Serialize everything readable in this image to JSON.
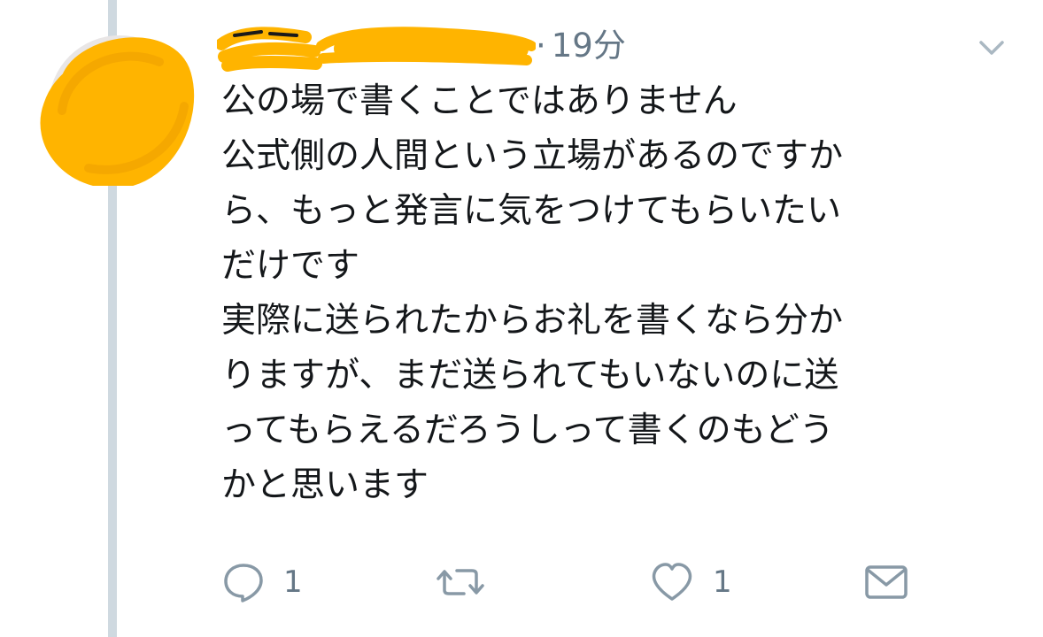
{
  "tweet": {
    "time": "19分",
    "lines": [
      "公の場で書くことではありません",
      "公式側の人間という立場があるのですか",
      "ら、もっと発言に気をつけてもらいたい",
      "だけです",
      "実際に送られたからお礼を書くなら分か",
      "りますが、まだ送られてもいないのに送",
      "ってもらえるだろうしって書くのもどう",
      "かと思います"
    ]
  },
  "actions": {
    "reply_count": "1",
    "like_count": "1"
  },
  "icons": {
    "reply": "reply-bubble-icon",
    "retweet": "retweet-icon",
    "like": "heart-icon",
    "dm": "envelope-icon",
    "menu": "chevron-down-icon"
  },
  "colors": {
    "thread_line": "#cfd9e0",
    "text": "#14171a",
    "meta": "#657786",
    "redaction": "#ffb400"
  }
}
